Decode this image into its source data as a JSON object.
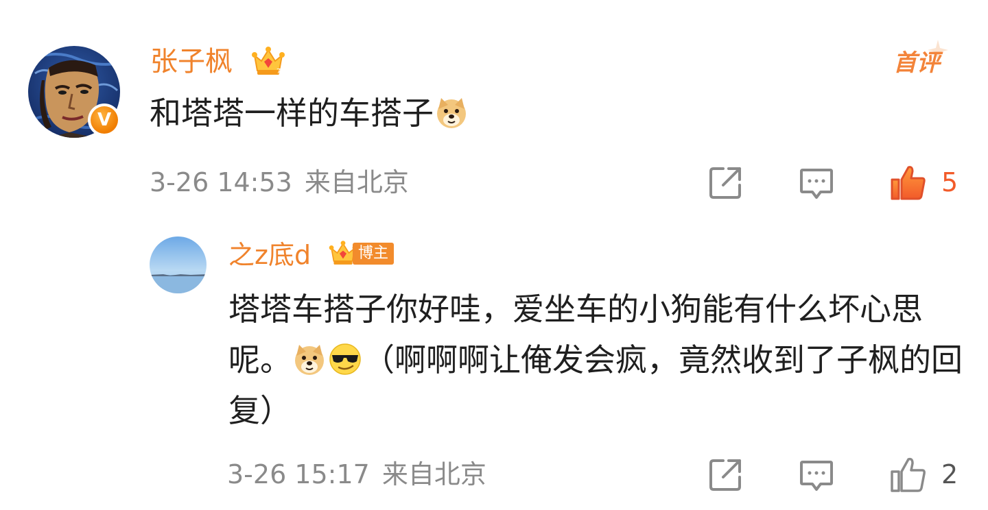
{
  "comments": [
    {
      "author": "张子枫",
      "first_label": "首评",
      "text": "和塔塔一样的车搭子",
      "time": "3-26 14:53",
      "location": "来自北京",
      "likes": "5",
      "liked": true,
      "emojis": [
        "doge-emoji"
      ]
    },
    {
      "author": "之z底d",
      "badge": "博主",
      "text": "塔塔车搭子你好哇，爱坐车的小狗能有什么坏心思呢。",
      "text_after_emoji": "（啊啊啊让俺发会疯，竟然收到了子枫的回复）",
      "time": "3-26 15:17",
      "location": "来自北京",
      "likes": "2",
      "liked": false,
      "emojis": [
        "doge-emoji",
        "sunglasses-emoji"
      ]
    }
  ],
  "colors": {
    "accent": "#f0832c",
    "text": "#1f1f1f",
    "meta": "#8a8a8a",
    "like_active": "#f25b2a"
  }
}
